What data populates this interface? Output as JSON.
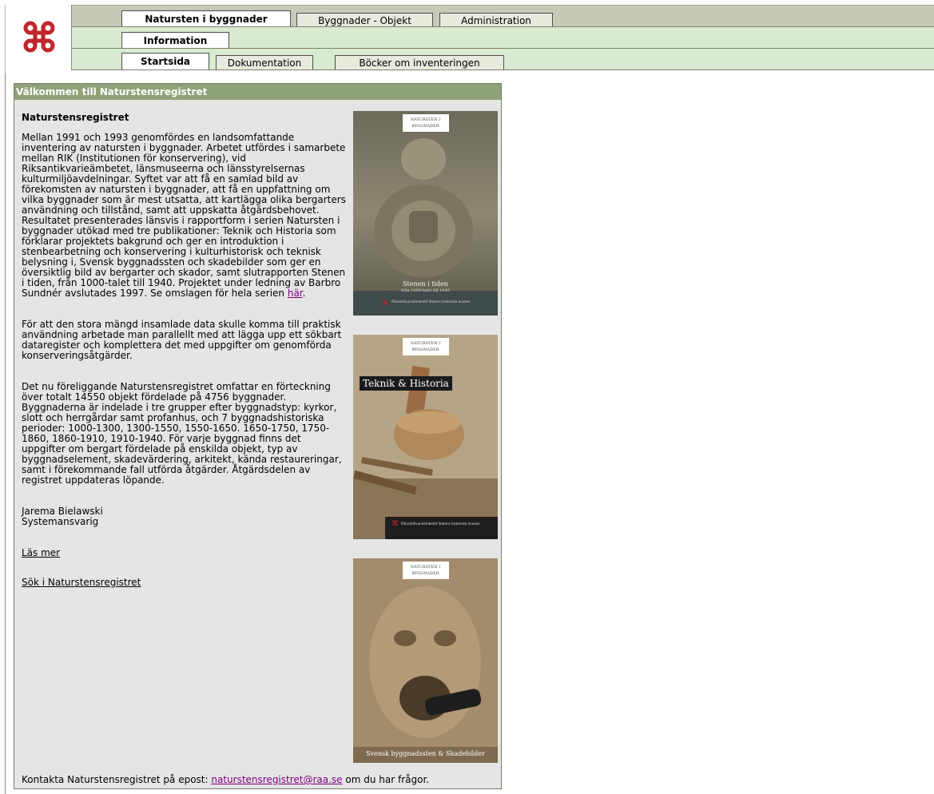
{
  "nav": {
    "row1": [
      {
        "label": "Natursten i byggnader",
        "active": true
      },
      {
        "label": "Byggnader - Objekt",
        "active": false
      },
      {
        "label": "Administration",
        "active": false
      }
    ],
    "row2": [
      {
        "label": "Information",
        "active": true
      }
    ],
    "row3": [
      {
        "label": "Startsida",
        "active": true
      },
      {
        "label": "Dokumentation",
        "active": false
      },
      {
        "label": "Böcker om inventeringen",
        "active": false
      }
    ]
  },
  "logo": {
    "icon": "command-symbol",
    "color": "#c0262d"
  },
  "content": {
    "header": "Välkommen till Naturstensregistret",
    "heading": "Naturstensregistret",
    "p1_before_link": "Mellan 1991 och 1993 genomfördes en landsomfattande inventering av natursten i byggnader. Arbetet utfördes i samarbete mellan RIK (Institutionen för konservering), vid Riksantikvarieämbetet, länsmuseerna och länsstyrelsernas kulturmiljöavdelningar. Syftet var att få en samlad bild av förekomsten av natursten i byggnader, att få en uppfattning om vilka byggnader som är mest utsatta, att kartlägga olika bergarters användning och tillstånd, samt att uppskatta åtgärdsbehovet. Resultatet presenterades länsvis i rapportform i serien Natursten i byggnader utökad med tre publikationer: Teknik och Historia som förklarar projektets bakgrund och ger en introduktion i stenbearbetning och konservering i kulturhistorisk och teknisk belysning i, Svensk byggnadssten och skadebilder som ger en översiktlig bild av bergarter och skador, samt slutrapporten Stenen i tiden, från 1000-talet till 1940. Projektet under ledning av Barbro Sundnér avslutades 1997. Se omslagen för hela serien ",
    "p1_link": "här",
    "p1_after_link": ".",
    "p2": "För att den stora mängd insamlade data skulle komma till praktisk användning arbetade man parallellt med att lägga upp ett sökbart dataregister och komplettera det med uppgifter om genomförda konserveringsåtgärder.",
    "p3": "Det nu föreliggande Naturstensregistret omfattar en förteckning över totalt 14550 objekt fördelade på 4756 byggnader. Byggnaderna är indelade i tre grupper efter byggnadstyp: kyrkor, slott och herrgårdar samt profanhus, och 7 byggnadshistoriska perioder: 1000-1300, 1300-1550, 1550-1650. 1650-1750, 1750-1860, 1860-1910, 1910-1940. För varje byggnad finns det uppgifter om bergart fördelade på enskilda objekt, typ av byggnadselement, skadevärdering, arkitekt, kända restaureringar, samt i förekommande fall utförda åtgärder. Åtgärdsdelen av registret uppdateras löpande.",
    "signature_name": "Jarema Bielawski",
    "signature_role": "Systemansvarig",
    "link_read_more": "Läs mer",
    "link_search": "Sök i Naturstensregistret",
    "footer_before": "Kontakta Naturstensregistret på epost: ",
    "footer_email": "naturstensregistret@raa.se",
    "footer_after": " om du har frågor."
  },
  "covers": [
    {
      "badge": "NATURSTEN I BYGGNADER",
      "title": "Stenen i tiden",
      "subtitle": "från 1000-talet till 1940",
      "publisher": "Riksantikvarieämbetet Statens historiska museer"
    },
    {
      "badge": "NATURSTEN I BYGGNADER",
      "title": "Teknik & Historia",
      "subtitle": "",
      "publisher": "Riksantikvarieämbetet Statens historiska museer"
    },
    {
      "badge": "NATURSTEN I BYGGNADER",
      "title": "Svensk byggnadssten & Skadebilder",
      "subtitle": "",
      "publisher": ""
    }
  ]
}
